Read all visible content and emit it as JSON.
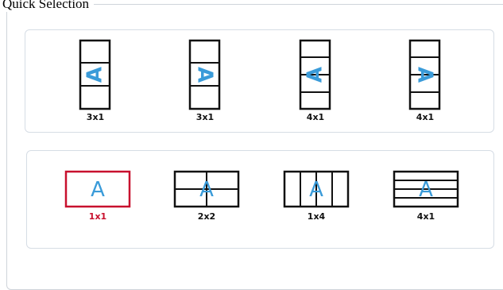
{
  "group_title": "Quick Selection",
  "panels": [
    {
      "name": "vertical-layouts",
      "options": [
        {
          "label": "3x1",
          "selected": false,
          "icon": "3x1-vertical-layout-icon"
        },
        {
          "label": "3x1",
          "selected": false,
          "icon": "3x1-vertical-layout-flipped-icon"
        },
        {
          "label": "4x1",
          "selected": false,
          "icon": "4x1-vertical-layout-icon"
        },
        {
          "label": "4x1",
          "selected": false,
          "icon": "4x1-vertical-layout-flipped-icon"
        }
      ]
    },
    {
      "name": "horizontal-layouts",
      "options": [
        {
          "label": "1x1",
          "selected": true,
          "icon": "1x1-layout-icon"
        },
        {
          "label": "2x2",
          "selected": false,
          "icon": "2x2-layout-icon"
        },
        {
          "label": "1x4",
          "selected": false,
          "icon": "1x4-layout-icon"
        },
        {
          "label": "4x1",
          "selected": false,
          "icon": "4x1-layout-icon"
        }
      ]
    }
  ],
  "colors": {
    "accent": "#3a9bd9",
    "selected": "#c8102e",
    "frame": "#111111",
    "panel_border": "#d6dde5"
  },
  "glyph": "A"
}
